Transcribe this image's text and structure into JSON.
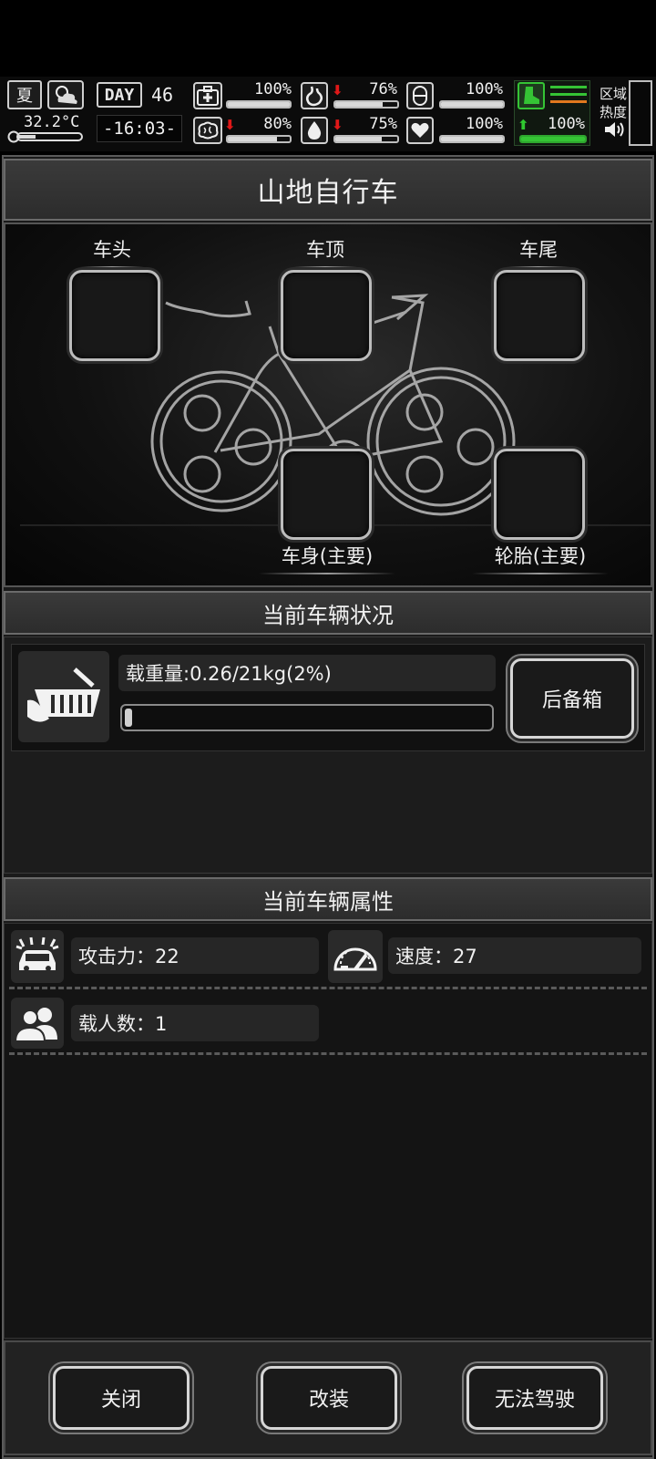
{
  "hud": {
    "season": "夏",
    "temperature": "32.2°C",
    "day_label": "DAY",
    "day_number": "46",
    "clock": "-16:03-",
    "stats": [
      {
        "icon": "medkit-icon",
        "value": "100%",
        "level": 1.0,
        "trend": ""
      },
      {
        "icon": "stomach-icon",
        "value": "76%",
        "level": 0.76,
        "trend": "down"
      },
      {
        "icon": "pill-icon",
        "value": "100%",
        "level": 1.0,
        "trend": ""
      },
      {
        "icon": "brain-icon",
        "value": "80%",
        "level": 0.8,
        "trend": "down"
      },
      {
        "icon": "water-drop-icon",
        "value": "75%",
        "level": 0.75,
        "trend": "down"
      },
      {
        "icon": "heart-icon",
        "value": "100%",
        "level": 1.0,
        "trend": ""
      }
    ],
    "stamina": {
      "icon": "boot-icon",
      "value": "100%",
      "level": 1.0,
      "trend": "up"
    },
    "zone_heat_label_1": "区域",
    "zone_heat_label_2": "热度"
  },
  "title": "山地自行车",
  "slots": {
    "head": "车头",
    "top": "车顶",
    "tail": "车尾",
    "body": "车身(主要)",
    "tire": "轮胎(主要)"
  },
  "status": {
    "header": "当前车辆状况",
    "load_text": "载重量:0.26/21kg(2%)",
    "load_level": 0.02,
    "trunk_button": "后备箱"
  },
  "attributes": {
    "header": "当前车辆属性",
    "attack": "攻击力：22",
    "speed": "速度：27",
    "passengers": "载人数：1"
  },
  "buttons": {
    "close": "关闭",
    "modify": "改装",
    "drive": "无法驾驶"
  },
  "colors": {
    "accent_green": "#35c435",
    "alert_red": "#e01818",
    "orange_bar": "#e0781e"
  }
}
